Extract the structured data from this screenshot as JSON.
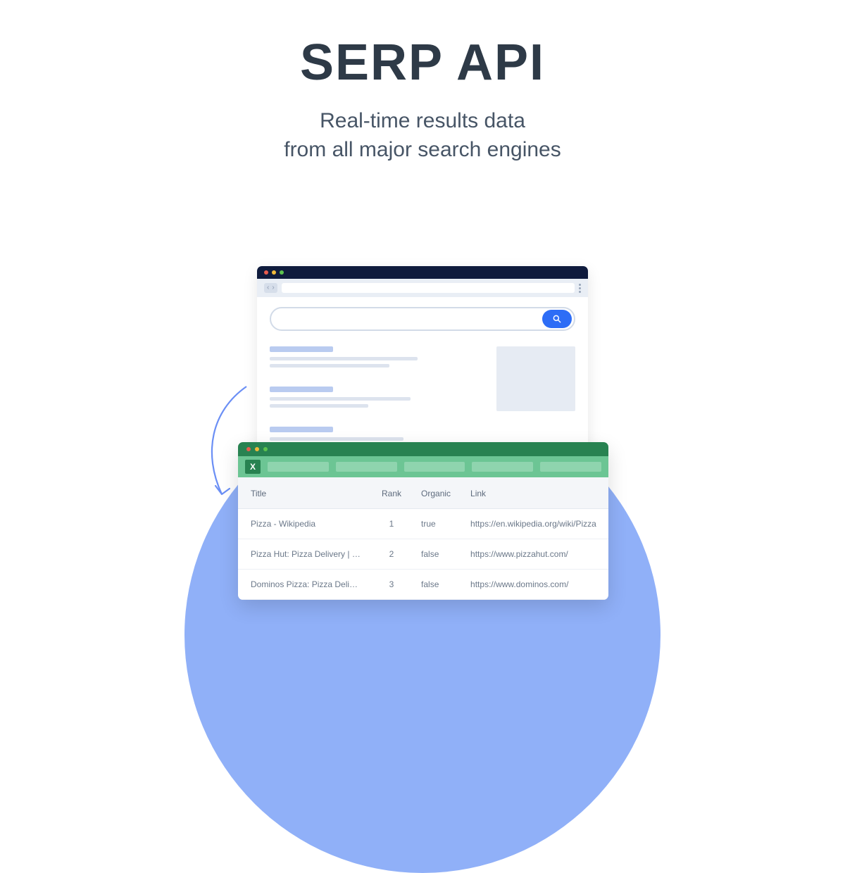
{
  "title": "SERP API",
  "subtitle_line1": "Real-time results data",
  "subtitle_line2": "from all major search engines",
  "spreadsheet": {
    "columns": [
      "Title",
      "Rank",
      "Organic",
      "Link"
    ],
    "rows": [
      {
        "title": "Pizza - Wikipedia",
        "rank": "1",
        "organic": "true",
        "link": "https://en.wikipedia.org/wiki/Pizza"
      },
      {
        "title": "Pizza Hut: Pizza Delivery | Pizza C...",
        "rank": "2",
        "organic": "false",
        "link": "https://www.pizzahut.com/"
      },
      {
        "title": "Dominos Pizza: Pizza Delivery & C...",
        "rank": "3",
        "organic": "false",
        "link": "https://www.dominos.com/"
      }
    ]
  },
  "excel_badge": "X"
}
